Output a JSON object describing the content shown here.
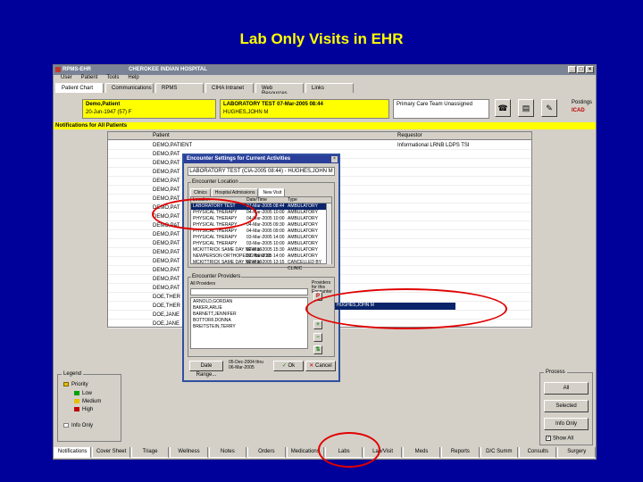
{
  "slide_title": "Lab Only Visits in EHR",
  "window": {
    "title": "RPMS-EHR",
    "facility": "CHEROKEE INDIAN HOSPITAL",
    "menu": [
      "User",
      "Patient",
      "Tools",
      "Help"
    ],
    "tabs": [
      "Patient Chart",
      "Communications",
      "RPMS",
      "CIHA Intranet",
      "Web Resources",
      "Links"
    ]
  },
  "patient_bar": {
    "patient_name": "Demo,Patient",
    "patient_id": "20-Jun-1947 (57)    F",
    "visit_line1": "LABORATORY TEST    07-Mar-2005 08:44",
    "visit_line2": "HUGHES,JOHN M",
    "status": "Primary Care Team Unassigned",
    "postings": "Postings",
    "postings_code": "ICAD"
  },
  "notifications": {
    "header": "Notifications for All Patients",
    "columns": [
      "Patient",
      "Requestor"
    ],
    "rows": [
      {
        "patient": "DEMO,PATIENT",
        "requestor": "Informational LRNB LDPS TSI"
      },
      {
        "patient": "DEMO,PAT",
        "requestor": ""
      },
      {
        "patient": "DEMO,PAT",
        "requestor": ""
      },
      {
        "patient": "DEMO,PAT",
        "requestor": ""
      },
      {
        "patient": "DEMO,PAT",
        "requestor": ""
      },
      {
        "patient": "DEMO,PAT",
        "requestor": ""
      },
      {
        "patient": "DEMO,PAT",
        "requestor": ""
      },
      {
        "patient": "DEMO,PAT",
        "requestor": ""
      },
      {
        "patient": "DEMO,PAT",
        "requestor": ""
      },
      {
        "patient": "DEMO,PAT",
        "requestor": ""
      },
      {
        "patient": "DEMO,PAT",
        "requestor": ""
      },
      {
        "patient": "DEMO,PAT",
        "requestor": ""
      },
      {
        "patient": "DEMO,PAT",
        "requestor": ""
      },
      {
        "patient": "DEMO,PAT",
        "requestor": ""
      },
      {
        "patient": "DEMO,PAT",
        "requestor": ""
      },
      {
        "patient": "DEMO,PAT",
        "requestor": ""
      },
      {
        "patient": "DEMO,PAT",
        "requestor": ""
      },
      {
        "patient": "DOE,THER",
        "requestor": ""
      },
      {
        "patient": "DOE,THER",
        "requestor": ""
      },
      {
        "patient": "DOE,JANE",
        "requestor": ""
      },
      {
        "patient": "DOE,JANE",
        "requestor": ""
      }
    ]
  },
  "legend": {
    "title": "Legend",
    "items": [
      "Priority",
      "Low",
      "Medium",
      "High",
      "Info Only"
    ],
    "colors": {
      "low": "#00a000",
      "medium": "#e0c000",
      "high": "#c00000"
    }
  },
  "process": {
    "title": "Process",
    "buttons": [
      "All",
      "Selected",
      "Info Only"
    ],
    "show_all": "Show All"
  },
  "bottom_tabs": [
    "Notifications",
    "Cover Sheet",
    "Triage",
    "Wellness",
    "Notes",
    "Orders",
    "Medications",
    "Labs",
    "Lab/Visit",
    "Meds",
    "Reports",
    "D/C Summ",
    "Consults",
    "Surgery"
  ],
  "dialog": {
    "title": "Encounter Settings for Current Activities",
    "header": "LABORATORY TEST (CIA-2005 08:44) - HUGHES,JOHN M",
    "location_label": "Encounter Location",
    "tabs": [
      "Clinics",
      "Hospital Admissions",
      "New Visit"
    ],
    "columns": [
      "Location",
      "Date/Time",
      "Type"
    ],
    "visits": [
      {
        "location": "LABORATORY TEST",
        "date": "07-Mar-2005 08:44",
        "type": "AMBULATORY"
      },
      {
        "location": "PHYSICAL THERAPY",
        "date": "04-Mar-2005 10:00",
        "type": "AMBULATORY"
      },
      {
        "location": "PHYSICAL THERAPY",
        "date": "04-Mar-2005 10:00",
        "type": "AMBULATORY"
      },
      {
        "location": "PHYSICAL THERAPY",
        "date": "04-Mar-2005 09:30",
        "type": "AMBULATORY"
      },
      {
        "location": "PHYSICAL THERAPY",
        "date": "04-Mar-2005 09:00",
        "type": "AMBULATORY"
      },
      {
        "location": "PHYSICAL THERAPY",
        "date": "03-Mar-2005 14:00",
        "type": "AMBULATORY"
      },
      {
        "location": "PHYSICAL THERAPY",
        "date": "03-Mar-2005 10:00",
        "type": "AMBULATORY"
      },
      {
        "location": "MCKITTRICK SAME DAY NEW 30",
        "date": "02-Mar-2005 15:30",
        "type": "AMBULATORY"
      },
      {
        "location": "NEWPERSON ORTHOPEDIC NEW 30",
        "date": "02-Mar-2005 14:00",
        "type": "AMBULATORY"
      },
      {
        "location": "MCKITTRICK SAME DAY NEW 30",
        "date": "02-Mar-2005 13:15",
        "type": "CANCELLED BY CLINIC"
      }
    ],
    "provider_label": "Encounter Providers",
    "all_providers_label": "All Providers",
    "providers": [
      "ARNOLD,GORDAN",
      "BAKER,ARLIE",
      "BARNETT,JENNIFER",
      "BOTTORF,DONNA",
      "BREITSTEIN,TERRY"
    ],
    "primary_label": "Providers for this Encounter",
    "selected_provider": "HUGHES,JOHN M",
    "date_range_btn": "Date Range...",
    "date_range": [
      "05-Dec-2004 thru",
      "06-Mar-2005"
    ],
    "ok": "Ok",
    "cancel": "Cancel"
  }
}
